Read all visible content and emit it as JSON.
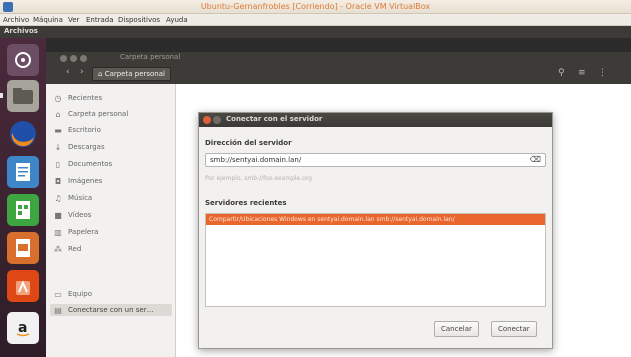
{
  "vbox": {
    "title": "Ubuntu-Gernanfrobles [Corriendo] - Oracle VM VirtualBox",
    "menu": [
      "Archivo",
      "Máquina",
      "Ver",
      "Entrada",
      "Dispositivos",
      "Ayuda"
    ]
  },
  "ubuntu_panel": {
    "title": "Archivos"
  },
  "nautilus": {
    "header_title": "Carpeta personal",
    "path_label": "Carpeta personal",
    "sidebar": [
      {
        "label": "Recientes",
        "icon": "clock-icon"
      },
      {
        "label": "Carpeta personal",
        "icon": "home-icon"
      },
      {
        "label": "Escritorio",
        "icon": "desktop-icon"
      },
      {
        "label": "Descargas",
        "icon": "download-icon"
      },
      {
        "label": "Documentos",
        "icon": "document-icon"
      },
      {
        "label": "Imágenes",
        "icon": "camera-icon"
      },
      {
        "label": "Música",
        "icon": "music-icon"
      },
      {
        "label": "Vídeos",
        "icon": "video-icon"
      },
      {
        "label": "Papelera",
        "icon": "trash-icon"
      },
      {
        "label": "Red",
        "icon": "network-icon"
      },
      {
        "label": "Equipo",
        "icon": "computer-icon"
      },
      {
        "label": "Conectarse con un ser…",
        "icon": "server-icon"
      }
    ]
  },
  "dialog": {
    "title": "Conectar con el servidor",
    "address_label": "Dirección del servidor",
    "address_value": "smb://sentyai.domain.lan/",
    "hint": "Por ejemplo, smb://foo.example.org",
    "recent_label": "Servidores recientes",
    "recent_items": [
      "Compartir/Ubicaciones Windows en sentyai.domain.lan smb://sentyai.domain.lan/"
    ],
    "cancel_label": "Cancelar",
    "connect_label": "Conectar"
  },
  "colors": {
    "accent": "#e9672f",
    "launcher": "#3d2433",
    "panel": "#3c3b37"
  }
}
